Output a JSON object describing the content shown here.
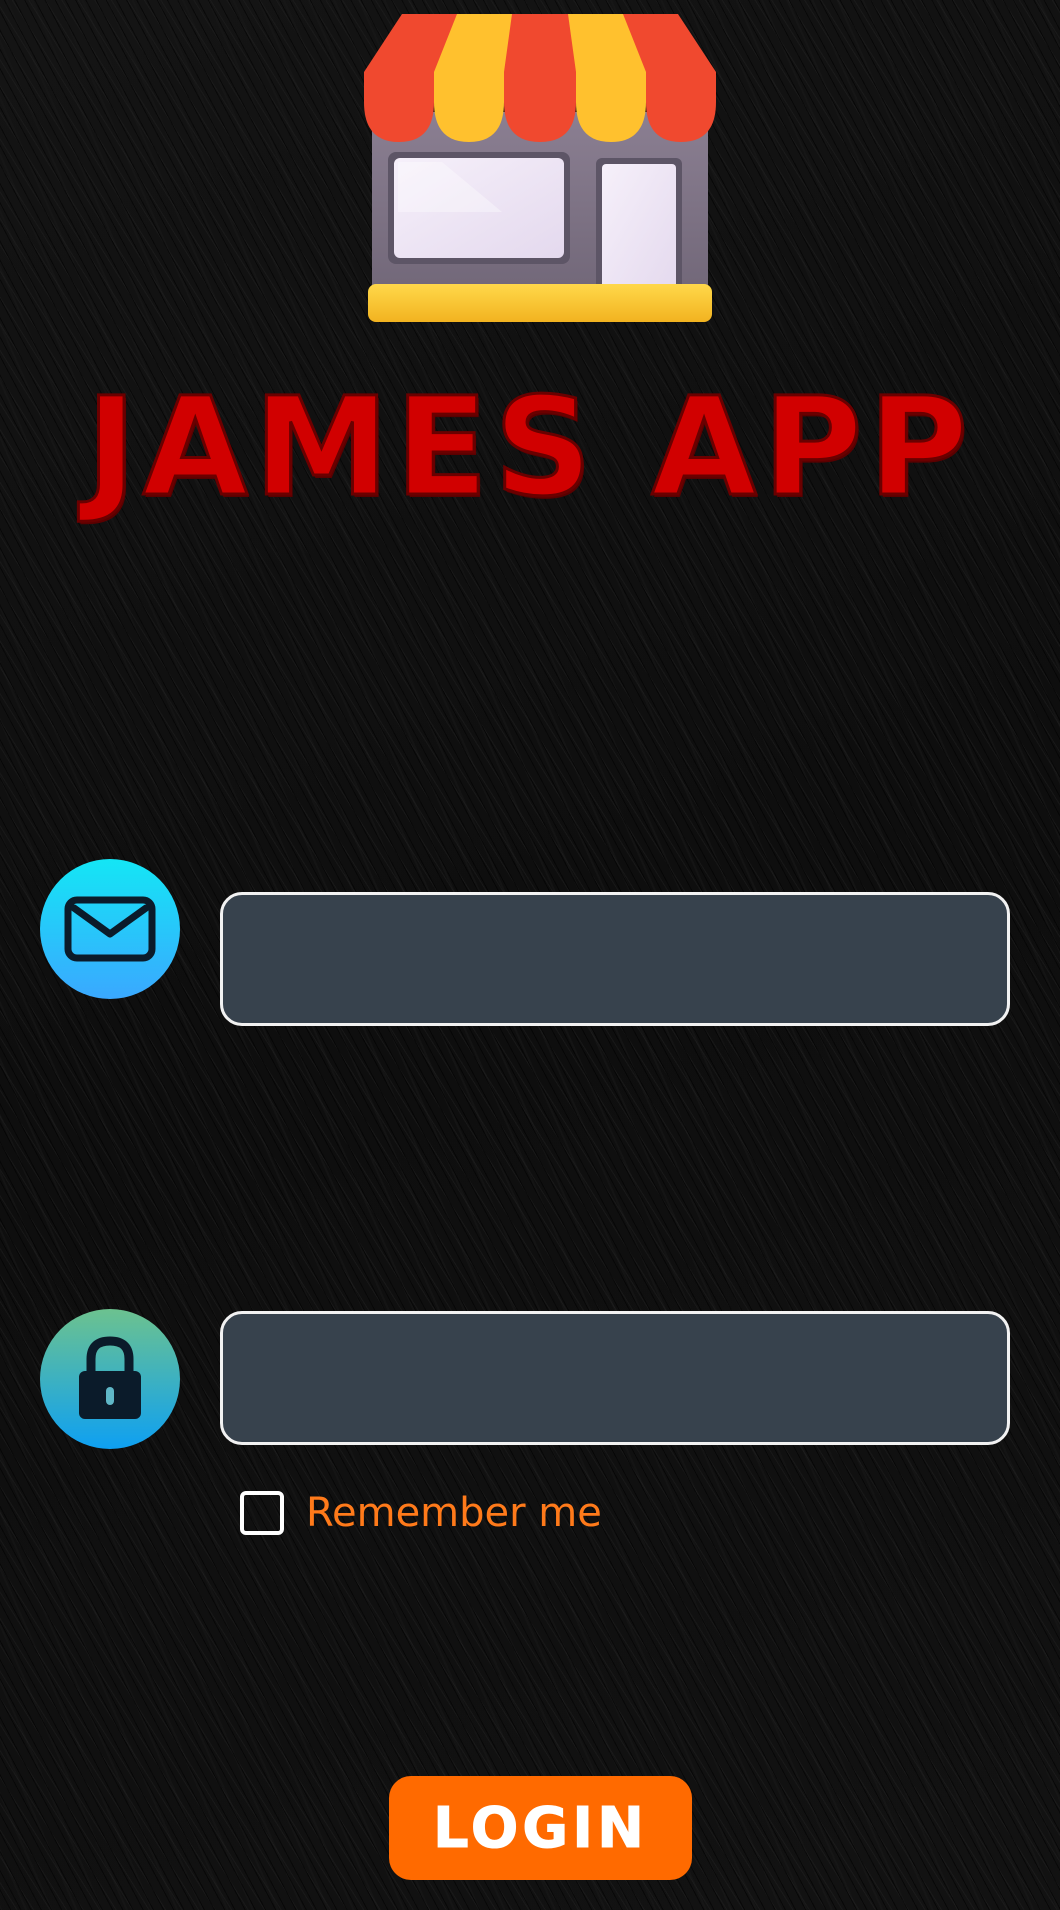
{
  "app": {
    "title": "JAMES APP",
    "logo_icon": "store-icon"
  },
  "form": {
    "email": {
      "icon": "envelope-icon",
      "value": "",
      "placeholder": ""
    },
    "password": {
      "icon": "lock-icon",
      "value": "",
      "placeholder": ""
    },
    "remember_me": {
      "label": "Remember me",
      "checked": false
    },
    "login_label": "LOGIN"
  },
  "colors": {
    "background": "#0d0d0d",
    "title": "#d10000",
    "input_fill": "#37424d",
    "accent_orange": "#ff6a00",
    "remember_text": "#ff7a1a"
  }
}
